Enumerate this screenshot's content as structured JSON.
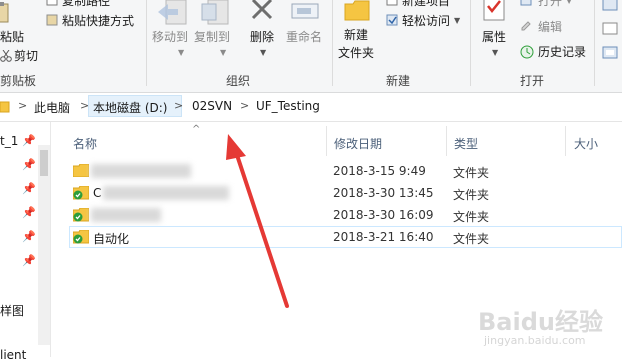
{
  "ribbon": {
    "clipboard": {
      "paste_label": "粘贴",
      "copy_path_label": "复制路径",
      "paste_shortcut_label": "粘贴快捷方式",
      "cut_label": "剪切",
      "group_label": "剪贴板"
    },
    "organize": {
      "move_to_label": "移动到",
      "copy_to_label": "复制到",
      "delete_label": "删除",
      "rename_label": "重命名",
      "group_label": "组织"
    },
    "new": {
      "new_folder_label": "新建\n文件夹",
      "new_folder_line1": "新建",
      "new_folder_line2": "文件夹",
      "new_item_label": "新建项目",
      "easy_access_label": "轻松访问",
      "group_label": "新建"
    },
    "open": {
      "properties_label": "属性",
      "open_label": "打开",
      "edit_label": "编辑",
      "history_label": "历史记录",
      "group_label": "打开"
    }
  },
  "address_bar": {
    "segments": [
      "此电脑",
      "本地磁盘 (D:)",
      "02SVN",
      "UF_Testing"
    ]
  },
  "nav": {
    "items": [
      {
        "label": "t_1"
      },
      {
        "label": "样图"
      },
      {
        "label": "lient"
      }
    ]
  },
  "file_list": {
    "columns": {
      "name": "名称",
      "date": "修改日期",
      "type": "类型",
      "size": "大小"
    },
    "rows": [
      {
        "name": "",
        "date": "2018-3-15 9:49",
        "type": "文件夹",
        "svn": false
      },
      {
        "name": "C",
        "date": "2018-3-30 13:45",
        "type": "文件夹",
        "svn": true
      },
      {
        "name": "",
        "date": "2018-3-30 16:09",
        "type": "文件夹",
        "svn": true
      },
      {
        "name": "自动化",
        "date": "2018-3-21 16:40",
        "type": "文件夹",
        "svn": true
      }
    ]
  },
  "watermark": {
    "brand": "Baidu经验",
    "url": "jingyan.baidu.com"
  },
  "colors": {
    "annotation_arrow": "#e53935",
    "folder_yellow": "#f5c542",
    "svn_green": "#2e9e3a"
  }
}
